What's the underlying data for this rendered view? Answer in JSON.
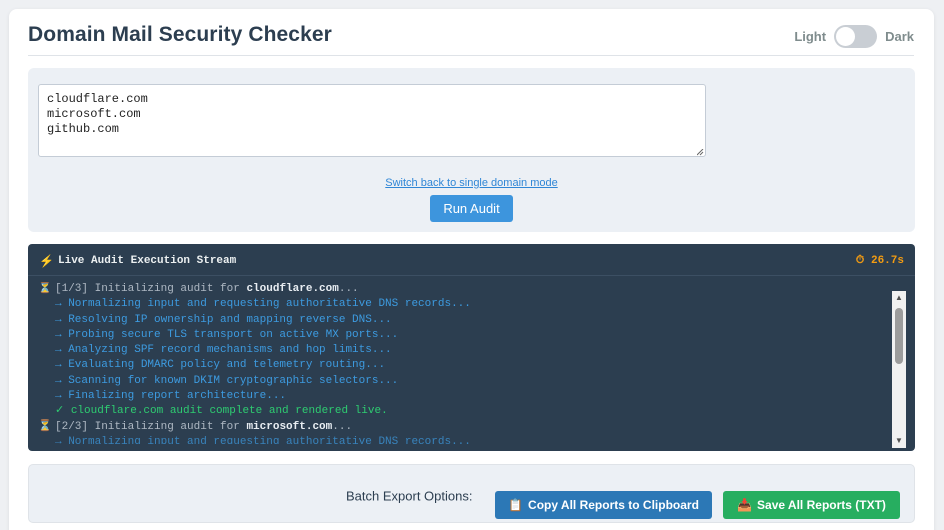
{
  "app": {
    "title": "Domain Mail Security Checker",
    "theme_light_label": "Light",
    "theme_dark_label": "Dark",
    "theme_is_dark": false
  },
  "input": {
    "domains_text": "cloudflare.com\nmicrosoft.com\ngithub.com",
    "switch_mode_link": "Switch back to single domain mode",
    "run_button": "Run Audit"
  },
  "stream": {
    "title": "Live Audit Execution Stream",
    "timer": "26.7s",
    "bolt_icon": "lightning-icon",
    "timer_icon": "stopwatch-icon",
    "log": [
      {
        "kind": "head",
        "prefix": "[1/3] Initializing audit for ",
        "domain": "cloudflare.com",
        "suffix": "..."
      },
      {
        "kind": "step",
        "text": "→ Normalizing input and requesting authoritative DNS records..."
      },
      {
        "kind": "step",
        "text": "→ Resolving IP ownership and mapping reverse DNS..."
      },
      {
        "kind": "step",
        "text": "→ Probing secure TLS transport on active MX ports..."
      },
      {
        "kind": "step",
        "text": "→ Analyzing SPF record mechanisms and hop limits..."
      },
      {
        "kind": "step",
        "text": "→ Evaluating DMARC policy and telemetry routing..."
      },
      {
        "kind": "step",
        "text": "→ Scanning for known DKIM cryptographic selectors..."
      },
      {
        "kind": "step",
        "text": "→ Finalizing report architecture..."
      },
      {
        "kind": "done",
        "text": "✓ cloudflare.com audit complete and rendered live."
      },
      {
        "kind": "head",
        "prefix": "[2/3] Initializing audit for ",
        "domain": "microsoft.com",
        "suffix": "..."
      },
      {
        "kind": "cut",
        "text": "→ Normalizing input and requesting authoritative DNS records..."
      }
    ]
  },
  "export": {
    "label": "Batch Export Options:",
    "copy_button": "Copy All Reports to Clipboard",
    "save_button": "Save All Reports (TXT)",
    "copy_icon": "clipboard-icon",
    "save_icon": "download-tray-icon"
  },
  "colors": {
    "accent": "#3d95dd",
    "stream_bg": "#2c3e50",
    "step": "#3d9be0",
    "success": "#2ecc71",
    "warning": "#f39c12",
    "copy_button": "#2c78b6",
    "save_button": "#27ae60"
  }
}
